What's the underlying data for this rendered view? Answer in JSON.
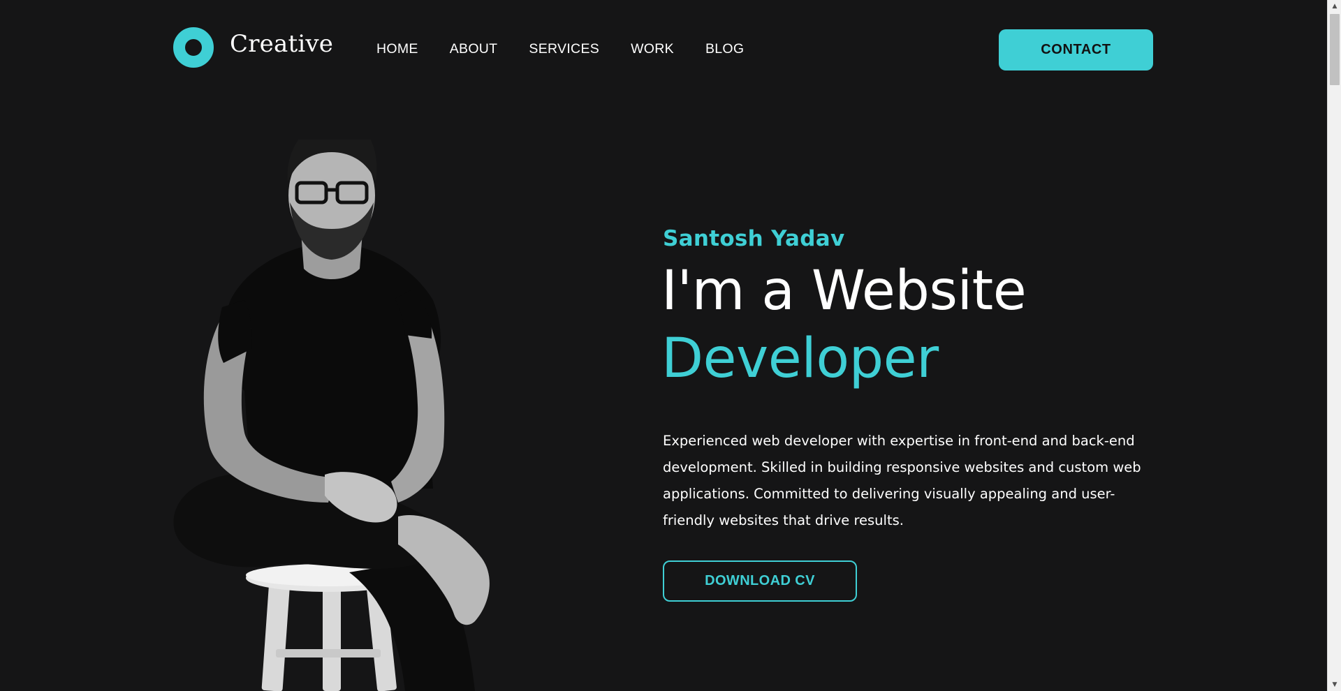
{
  "brand": {
    "name": "Creative",
    "accent_color": "#3fcfd5",
    "background_color": "#151516"
  },
  "nav": {
    "items": [
      "HOME",
      "ABOUT",
      "SERVICES",
      "WORK",
      "BLOG"
    ]
  },
  "header": {
    "contact_label": "CONTACT"
  },
  "hero": {
    "name": "Santosh Yadav",
    "headline_line1": "I'm a Website",
    "headline_line2": "Developer",
    "description": "Experienced web developer with expertise in front-end and back-end development. Skilled in building responsive websites and custom web applications. Committed to delivering visually appealing and user-friendly websites that drive results.",
    "download_label": "DOWNLOAD CV"
  },
  "icons": {
    "logo": "ring-logo-icon",
    "portrait": "developer-portrait-image"
  }
}
